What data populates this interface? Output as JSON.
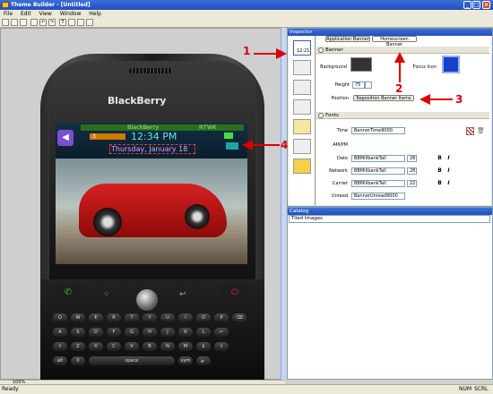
{
  "window": {
    "title": "Theme Builder - [Untitled]"
  },
  "menu": [
    "File",
    "Edit",
    "View",
    "Window",
    "Help"
  ],
  "statusbar": {
    "left": "Ready",
    "num": "NUM",
    "scrl": "SCRL",
    "zoom": "100%"
  },
  "phone": {
    "brand": "BlackBerry",
    "banner": {
      "carrier": "BlackBerry",
      "network": "NTWK",
      "time": "12:34 PM",
      "date": "Thursday, January 18",
      "count": "3"
    }
  },
  "inspector": {
    "title": "Inspector",
    "tabs": [
      "Application Banner",
      "Homescreen Banner"
    ],
    "banner_section": "Banner",
    "background_label": "Background",
    "focus_icon_label": "Focus Icon",
    "height_label": "Height",
    "height_value": "75",
    "position_label": "Position",
    "reposition_button": "Reposition Banner Items",
    "fonts_section": "Fonts",
    "rows": [
      {
        "label": "Time",
        "font": "BannerTime9000",
        "size": ""
      },
      {
        "label": "AM/PM",
        "font": "",
        "size": ""
      },
      {
        "label": "Date",
        "font": "BBMillbankTall",
        "size": "28"
      },
      {
        "label": "Network",
        "font": "BBMillbankTall",
        "size": "28"
      },
      {
        "label": "Carrier",
        "font": "BBMillbankTall",
        "size": "22"
      },
      {
        "label": "Unread",
        "font": "BannerUnread9000",
        "size": ""
      }
    ],
    "nav_icon_label": "12:21"
  },
  "catalog": {
    "title": "Catalog",
    "dropdown": "Tiled Images"
  },
  "annotations": [
    "1",
    "2",
    "3",
    "4"
  ],
  "colors": {
    "annotation": "#d80000",
    "titlebar": "#2350b8"
  }
}
